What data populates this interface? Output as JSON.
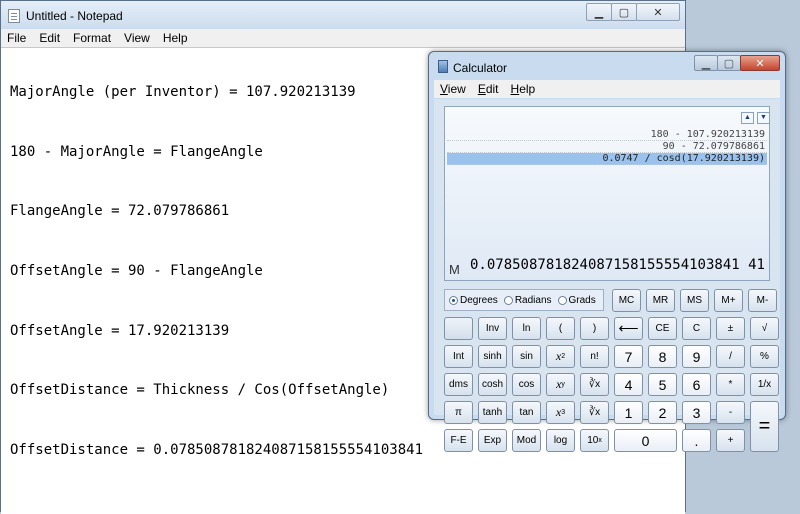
{
  "notepad": {
    "title": "Untitled - Notepad",
    "menu": [
      "File",
      "Edit",
      "Format",
      "View",
      "Help"
    ],
    "lines": [
      "MajorAngle (per Inventor) = 107.920213139",
      "180 - MajorAngle = FlangeAngle",
      "FlangeAngle = 72.079786861",
      "OffsetAngle = 90 - FlangeAngle",
      "OffsetAngle = 17.920213139",
      "OffsetDistance = Thickness / Cos(OffsetAngle)",
      "OffsetDistance = 0.078508781824087158155554103841"
    ]
  },
  "calculator": {
    "title": "Calculator",
    "menu": [
      "View",
      "Edit",
      "Help"
    ],
    "history": [
      "180 - 107.920213139",
      "90 - 72.079786861",
      "0.0747 / cosd(17.920213139)"
    ],
    "memory_indicator": "M",
    "display": "0.078508781824087158155554103841 41",
    "angle_modes": [
      "Degrees",
      "Radians",
      "Grads"
    ],
    "selected_mode": "Degrees",
    "keys": {
      "mc": "MC",
      "mr": "MR",
      "ms": "MS",
      "mplus": "M+",
      "mminus": "M-",
      "inv": "Inv",
      "ln": "ln",
      "lparen": "(",
      "rparen": ")",
      "backspace": "⟵",
      "ce": "CE",
      "c": "C",
      "plusminus": "±",
      "sqrt": "√",
      "int": "Int",
      "sinh": "sinh",
      "sin": "sin",
      "xsq": "x",
      "xsq_sup": "2",
      "fact": "n!",
      "d7": "7",
      "d8": "8",
      "d9": "9",
      "div": "/",
      "pct": "%",
      "dms": "dms",
      "cosh": "cosh",
      "cos": "cos",
      "xy": "x",
      "xy_sup": "y",
      "yroot": "∛x",
      "d4": "4",
      "d5": "5",
      "d6": "6",
      "mul": "*",
      "recip": "1/x",
      "pi": "π",
      "tanh": "tanh",
      "tan": "tan",
      "xcube": "x",
      "xcube_sup": "3",
      "cuberoot": "∛x",
      "d1": "1",
      "d2": "2",
      "d3": "3",
      "minus": "-",
      "eq": "=",
      "fe": "F-E",
      "exp": "Exp",
      "mod": "Mod",
      "log": "log",
      "tenx": "10",
      "tenx_sup": "x",
      "d0": "0",
      "dot": ".",
      "plus": "+"
    }
  }
}
